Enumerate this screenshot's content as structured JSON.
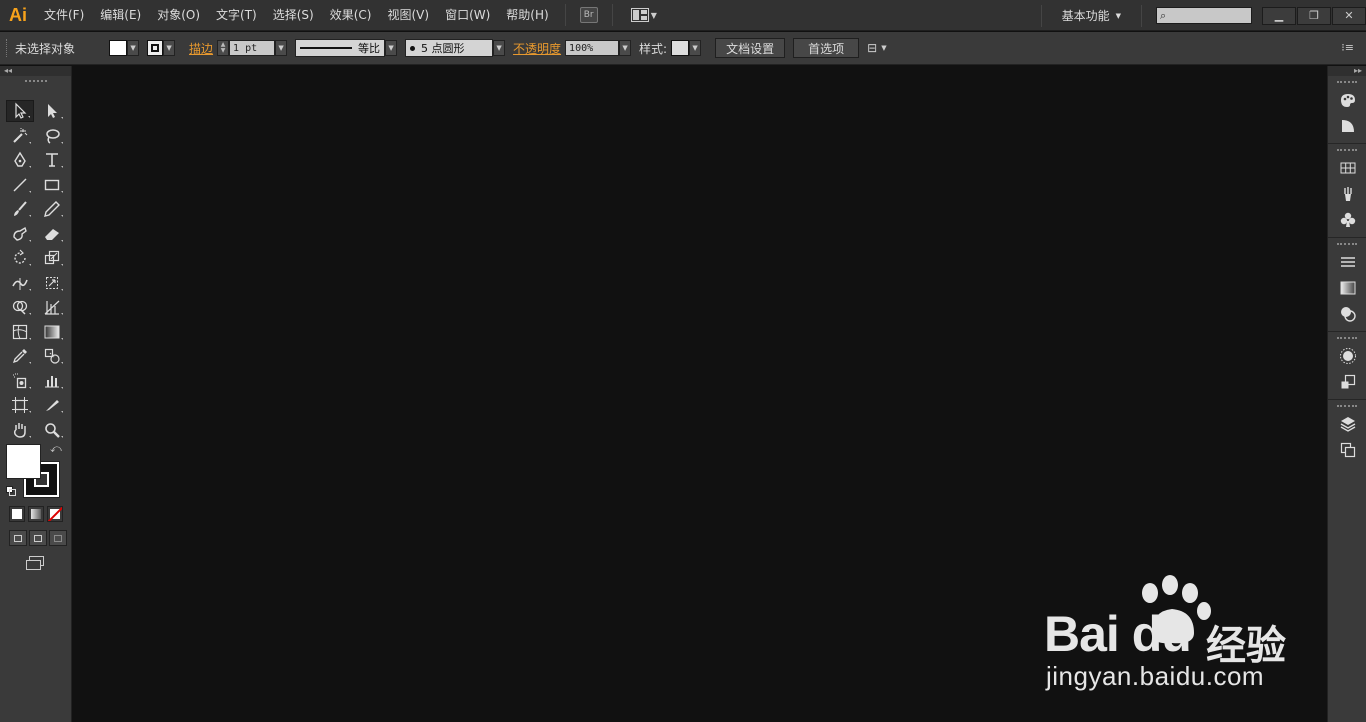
{
  "app": {
    "logo": "Ai"
  },
  "menu": {
    "items": [
      "文件(F)",
      "编辑(E)",
      "对象(O)",
      "文字(T)",
      "选择(S)",
      "效果(C)",
      "视图(V)",
      "窗口(W)",
      "帮助(H)"
    ],
    "bridge_label": "Br",
    "workspace": "基本功能"
  },
  "control": {
    "selection_status": "未选择对象",
    "stroke_link": "描边",
    "stroke_weight": "1 pt",
    "stroke_profile": "等比",
    "brush": "5 点圆形",
    "opacity_link": "不透明度",
    "opacity_value": "100%",
    "style_label": "样式:",
    "doc_setup_button": "文档设置",
    "preferences_button": "首选项"
  },
  "colors": {
    "menubar_bg": "#323232",
    "panel_bg": "#3a3a3a",
    "canvas_bg": "#111111",
    "accent_orange": "#e8992e",
    "logo_color": "#f7a21b"
  },
  "watermark": {
    "brand": "Bai du",
    "suffix": "经验",
    "url": "jingyan.baidu.com"
  }
}
